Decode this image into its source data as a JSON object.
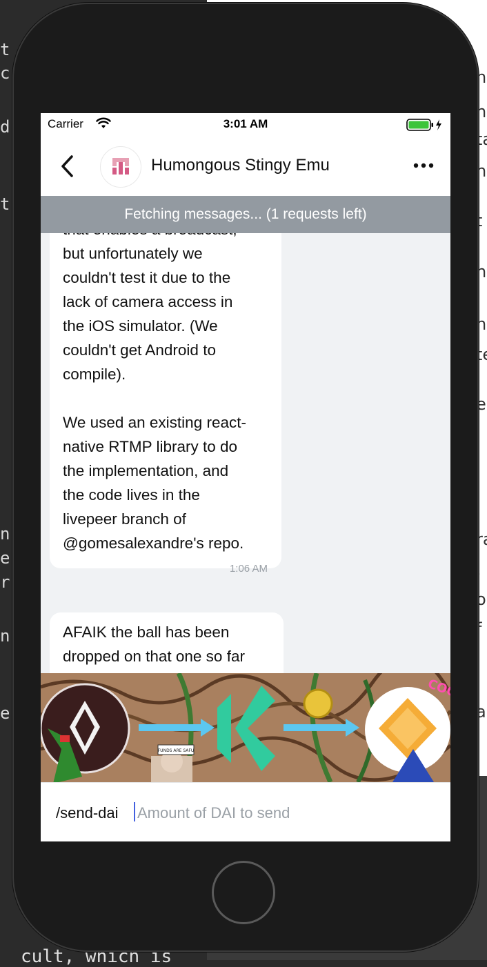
{
  "background": {
    "left_fragments": [
      "t",
      "c",
      "d",
      "t",
      "n",
      "e",
      "r",
      "n",
      "e"
    ],
    "right_fragments": [
      "n",
      "n",
      "ta",
      "n",
      "t",
      "n",
      "n",
      "te",
      "es",
      "ra",
      ".",
      "or",
      "f",
      "a"
    ],
    "bottom_text": "cult, which is"
  },
  "status_bar": {
    "carrier": "Carrier",
    "time": "3:01 AM"
  },
  "header": {
    "title": "Humongous Stingy Emu"
  },
  "banner": {
    "text": "Fetching messages... (1 requests left)"
  },
  "messages": [
    {
      "lines": [
        "that enables a broadcast,",
        "but unfortunately we",
        "couldn't test it due to the",
        "lack of camera access in",
        "the iOS simulator. (We",
        "couldn't get Android to",
        "compile).",
        "",
        "We used an existing react-",
        "native RTMP library to do",
        "the implementation, and",
        "the code lives in the",
        "livepeer branch of",
        "@gomesalexandre's repo."
      ],
      "time": "1:06 AM"
    },
    {
      "lines": [
        "AFAIK the ball has been",
        "dropped on that one so far"
      ]
    }
  ],
  "sticker": {
    "caption": "FUNDS ARE SAFU",
    "badge": "COOL"
  },
  "input": {
    "command": "/send-dai",
    "placeholder": "Amount of DAI to send"
  },
  "colors": {
    "banner": "#939aa1",
    "accent": "#4360df",
    "bubble": "#ffffff",
    "chat_bg": "#f0f2f4"
  }
}
